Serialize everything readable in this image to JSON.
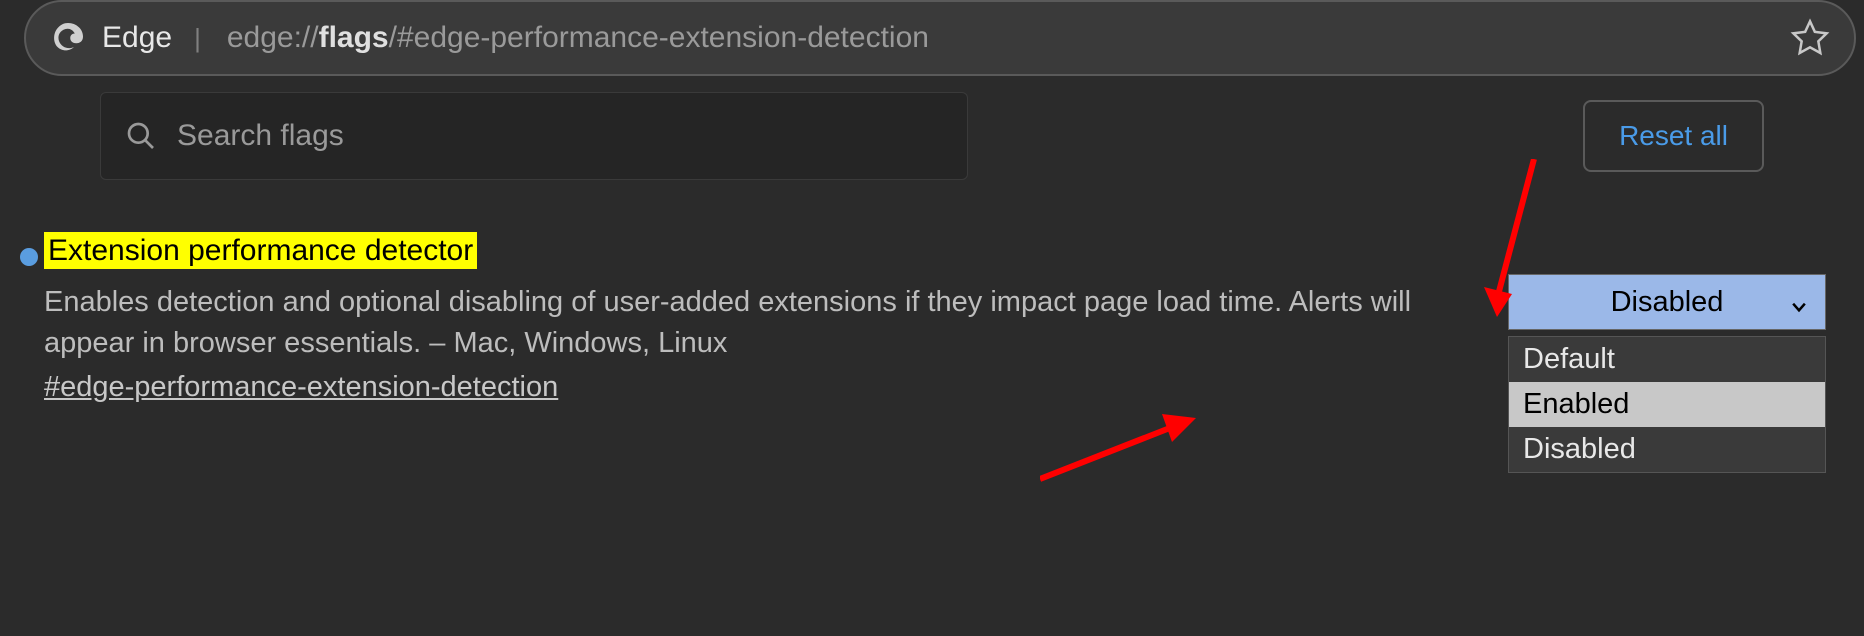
{
  "address_bar": {
    "browser_label": "Edge",
    "url_prefix": "edge://",
    "url_bold": "flags",
    "url_suffix": "/#edge-performance-extension-detection"
  },
  "search": {
    "placeholder": "Search flags"
  },
  "reset_label": "Reset all",
  "flag": {
    "title": "Extension performance detector",
    "description": "Enables detection and optional disabling of user-added extensions if they impact page load time. Alerts will appear in browser essentials. – Mac, Windows, Linux",
    "anchor": "#edge-performance-extension-detection",
    "selected": "Disabled",
    "options": {
      "opt0": "Default",
      "opt1": "Enabled",
      "opt2": "Disabled"
    }
  }
}
